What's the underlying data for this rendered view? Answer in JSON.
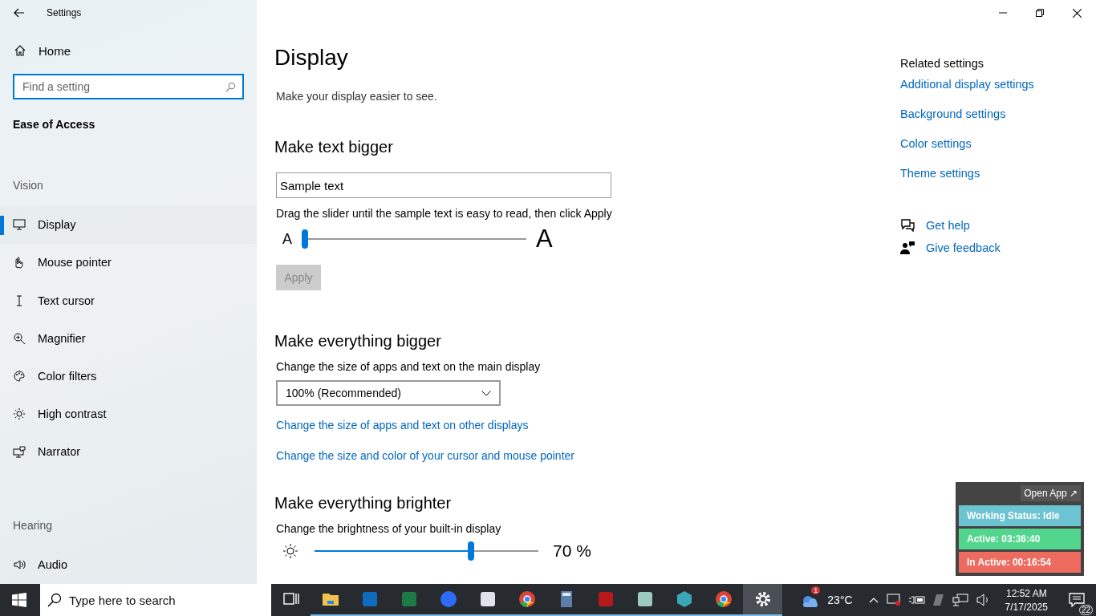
{
  "window": {
    "title": "Settings"
  },
  "sidebar": {
    "home": "Home",
    "search": {
      "placeholder": "Find a setting"
    },
    "section": "Ease of Access",
    "groups": [
      {
        "heading": "Vision",
        "items": [
          {
            "label": "Display",
            "kind": "display",
            "selected": true
          },
          {
            "label": "Mouse pointer",
            "kind": "mouse",
            "selected": false
          },
          {
            "label": "Text cursor",
            "kind": "cursor",
            "selected": false
          },
          {
            "label": "Magnifier",
            "kind": "magnifier",
            "selected": false
          },
          {
            "label": "Color filters",
            "kind": "palette",
            "selected": false
          },
          {
            "label": "High contrast",
            "kind": "contrast",
            "selected": false
          },
          {
            "label": "Narrator",
            "kind": "narrator",
            "selected": false
          }
        ]
      },
      {
        "heading": "Hearing",
        "items": [
          {
            "label": "Audio",
            "kind": "audio",
            "selected": false
          }
        ]
      }
    ]
  },
  "page": {
    "title": "Display",
    "subtitle": "Make your display easier to see.",
    "text_bigger": {
      "heading": "Make text bigger",
      "sample": {
        "value": "Sample text"
      },
      "hint": "Drag the slider until the sample text is easy to read, then click Apply",
      "small_a": "A",
      "large_a": "A",
      "slider": {
        "level": 0
      },
      "apply": {
        "label": "Apply",
        "disabled": true
      }
    },
    "everything_bigger": {
      "heading": "Make everything bigger",
      "label": "Change the size of apps and text on the main display",
      "dropdown": {
        "value": "100% (Recommended)"
      },
      "links": [
        "Change the size of apps and text on other displays",
        "Change the size and color of your cursor and mouse pointer"
      ]
    },
    "brighter": {
      "heading": "Make everything brighter",
      "label": "Change the brightness of your built-in display",
      "slider": {
        "level": 0.7
      },
      "reading": "70 %"
    }
  },
  "related": {
    "heading": "Related settings",
    "links": [
      "Additional display settings",
      "Background settings",
      "Color settings",
      "Theme settings"
    ],
    "help": [
      {
        "label": "Get help",
        "kind": "help"
      },
      {
        "label": "Give feedback",
        "kind": "feedback"
      }
    ]
  },
  "widget": {
    "button": "Open App ↗",
    "statuses": [
      {
        "text": "Working Status: Idle",
        "color": "#6cc3d1"
      },
      {
        "text": "Active: 03:36:40",
        "color": "#52d58c"
      },
      {
        "text": "In Active: 00:16:54",
        "color": "#ee6b60"
      }
    ]
  },
  "taskbar": {
    "search": {
      "placeholder": "Type here to search"
    },
    "apps": [
      {
        "kind": "taskview",
        "running": false,
        "selected": false
      },
      {
        "kind": "folder",
        "running": true,
        "selected": false
      },
      {
        "kind": "outlook",
        "running": true,
        "selected": false
      },
      {
        "kind": "excel",
        "running": true,
        "selected": false
      },
      {
        "kind": "zoom",
        "running": true,
        "selected": false
      },
      {
        "kind": "snip",
        "running": true,
        "selected": false
      },
      {
        "kind": "chrome",
        "running": true,
        "selected": false
      },
      {
        "kind": "calculator",
        "running": true,
        "selected": false
      },
      {
        "kind": "filezilla",
        "running": true,
        "selected": false
      },
      {
        "kind": "notes",
        "running": true,
        "selected": false
      },
      {
        "kind": "hexapp",
        "running": true,
        "selected": false
      },
      {
        "kind": "chrome",
        "running": true,
        "selected": false
      },
      {
        "kind": "gear",
        "running": true,
        "selected": true
      }
    ],
    "weather": {
      "badge": "1",
      "temperature": "23°C"
    },
    "clock": {
      "time": "12:52 AM",
      "date": "7/17/2025"
    },
    "notifications": "22"
  }
}
